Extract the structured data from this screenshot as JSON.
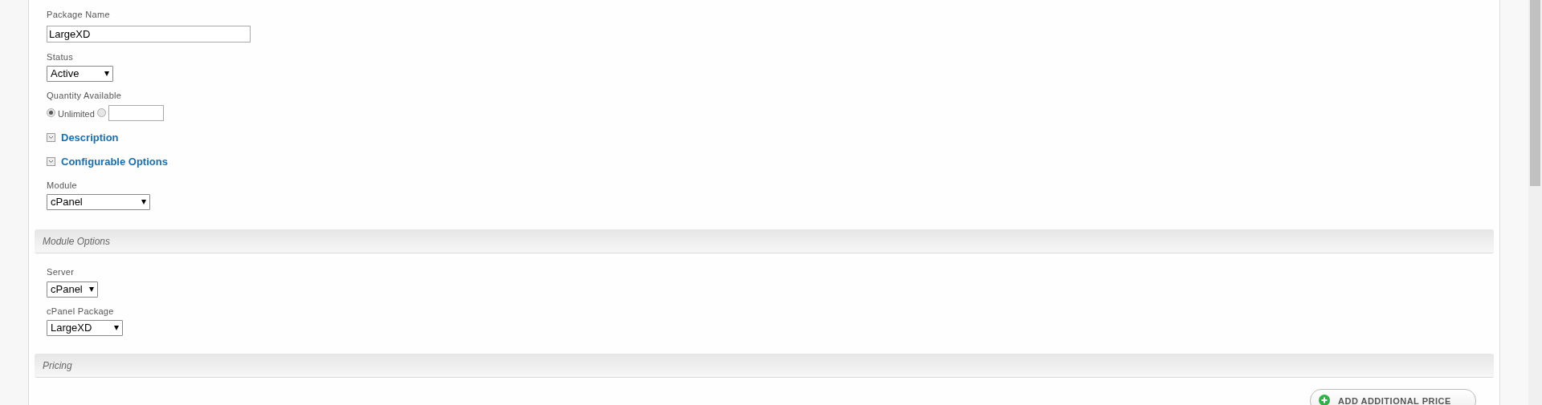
{
  "fields": [
    {
      "kind": "text",
      "label": "Package Name",
      "value": "LargeXD"
    },
    {
      "kind": "select",
      "label": "Status",
      "value": "Active"
    },
    {
      "kind": "quantity",
      "label": "Quantity Available",
      "options": [
        {
          "label": "Unlimited",
          "selected": true
        },
        {
          "selected": false
        }
      ]
    },
    {
      "kind": "toggle",
      "label": "Description",
      "expanded": false
    },
    {
      "kind": "toggle",
      "label": "Configurable Options",
      "expanded": false
    },
    {
      "kind": "select",
      "label": "Module",
      "value": "cPanel"
    }
  ],
  "module_options": {
    "title": "Module Options",
    "fields": [
      {
        "kind": "select",
        "label": "Server",
        "value": "cPanel"
      },
      {
        "kind": "select",
        "label": "cPanel Package",
        "value": "LargeXD"
      }
    ]
  },
  "pricing": {
    "title": "Pricing",
    "add_button": "ADD ADDITIONAL PRICE"
  }
}
